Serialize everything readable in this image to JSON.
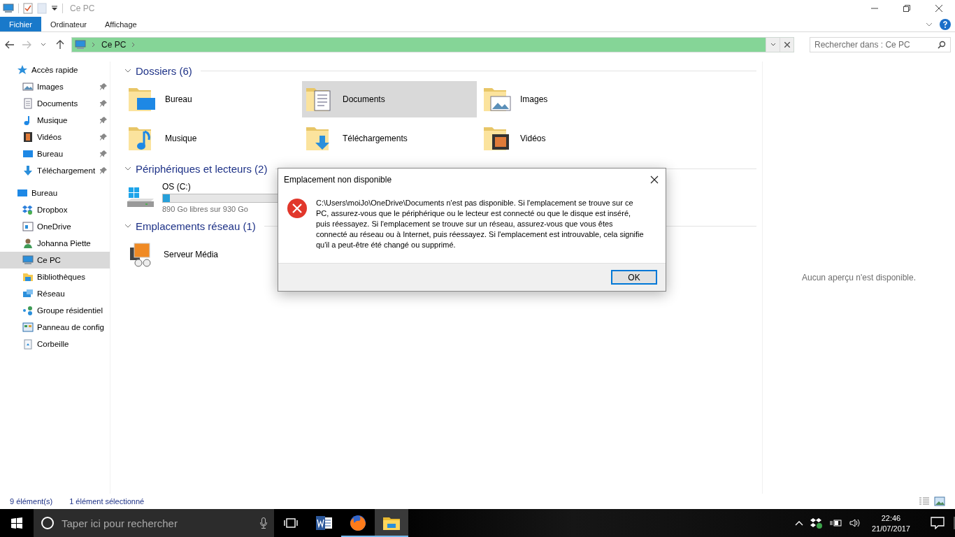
{
  "window": {
    "title": "Ce PC"
  },
  "ribbon_tabs": [
    {
      "label": "Fichier",
      "kind": "file"
    },
    {
      "label": "Ordinateur",
      "kind": "tab"
    },
    {
      "label": "Affichage",
      "kind": "tab"
    }
  ],
  "address": {
    "path": [
      "Ce PC"
    ]
  },
  "search": {
    "placeholder": "Rechercher dans : Ce PC"
  },
  "navigation": [
    {
      "label": "Accès rapide",
      "selected": false,
      "children": [
        {
          "label": "Images",
          "pinned": true,
          "selected": false
        },
        {
          "label": "Documents",
          "pinned": true,
          "selected": false
        },
        {
          "label": "Musique",
          "pinned": true,
          "selected": false
        },
        {
          "label": "Vidéos",
          "pinned": true,
          "selected": false
        },
        {
          "label": "Bureau",
          "pinned": true,
          "selected": false
        },
        {
          "label": "Téléchargement",
          "pinned": true,
          "selected": false
        }
      ]
    },
    {
      "label": "Bureau",
      "selected": false,
      "children": [
        {
          "label": "Dropbox",
          "pinned": false,
          "selected": false
        },
        {
          "label": "OneDrive",
          "pinned": false,
          "selected": false
        },
        {
          "label": "Johanna Piette",
          "pinned": false,
          "selected": false
        },
        {
          "label": "Ce PC",
          "pinned": false,
          "selected": true
        },
        {
          "label": "Bibliothèques",
          "pinned": false,
          "selected": false
        },
        {
          "label": "Réseau",
          "pinned": false,
          "selected": false
        },
        {
          "label": "Groupe résidentiel",
          "pinned": false,
          "selected": false
        },
        {
          "label": "Panneau de config",
          "pinned": false,
          "selected": false
        },
        {
          "label": "Corbeille",
          "pinned": false,
          "selected": false
        }
      ]
    }
  ],
  "folders": {
    "title": "Dossiers (6)",
    "expanded": true,
    "items": [
      {
        "label": "Bureau",
        "selected": false
      },
      {
        "label": "Documents",
        "selected": true
      },
      {
        "label": "Images",
        "selected": false
      },
      {
        "label": "Musique",
        "selected": false
      },
      {
        "label": "Téléchargements",
        "selected": false
      },
      {
        "label": "Vidéos",
        "selected": false
      }
    ]
  },
  "devices": {
    "title": "Périphériques et lecteurs (2)",
    "expanded": true,
    "items": [
      {
        "name": "OS (C:)",
        "level": 0.04,
        "free": "890 Go libres sur 930 Go"
      }
    ]
  },
  "network": {
    "title": "Emplacements réseau (1)",
    "expanded": true,
    "items": [
      {
        "label": "Serveur Média"
      }
    ]
  },
  "preview": {
    "message": "Aucun aperçu n'est disponible."
  },
  "status_bar": {
    "items": [
      "9 élément(s)",
      "1 élément sélectionné"
    ]
  },
  "dialog": {
    "title": "Emplacement non disponible",
    "message": "C:\\Users\\moiJo\\OneDrive\\Documents n'est pas disponible. Si l'emplacement se trouve sur ce PC, assurez-vous que le périphérique ou le lecteur est connecté ou que le disque est inséré, puis réessayez. Si l'emplacement se trouve sur un réseau, assurez-vous que vous êtes connecté au réseau ou à Internet, puis réessayez. Si l'emplacement est introuvable, cela signifie qu'il a peut-être été changé ou supprimé.",
    "button": "OK"
  },
  "taskbar": {
    "search_placeholder": "Taper ici pour rechercher",
    "apps": [
      {
        "running": false,
        "selected": false
      },
      {
        "running": true,
        "selected": false
      },
      {
        "running": true,
        "selected": true
      }
    ],
    "time": "22:46",
    "date": "21/07/2017"
  }
}
